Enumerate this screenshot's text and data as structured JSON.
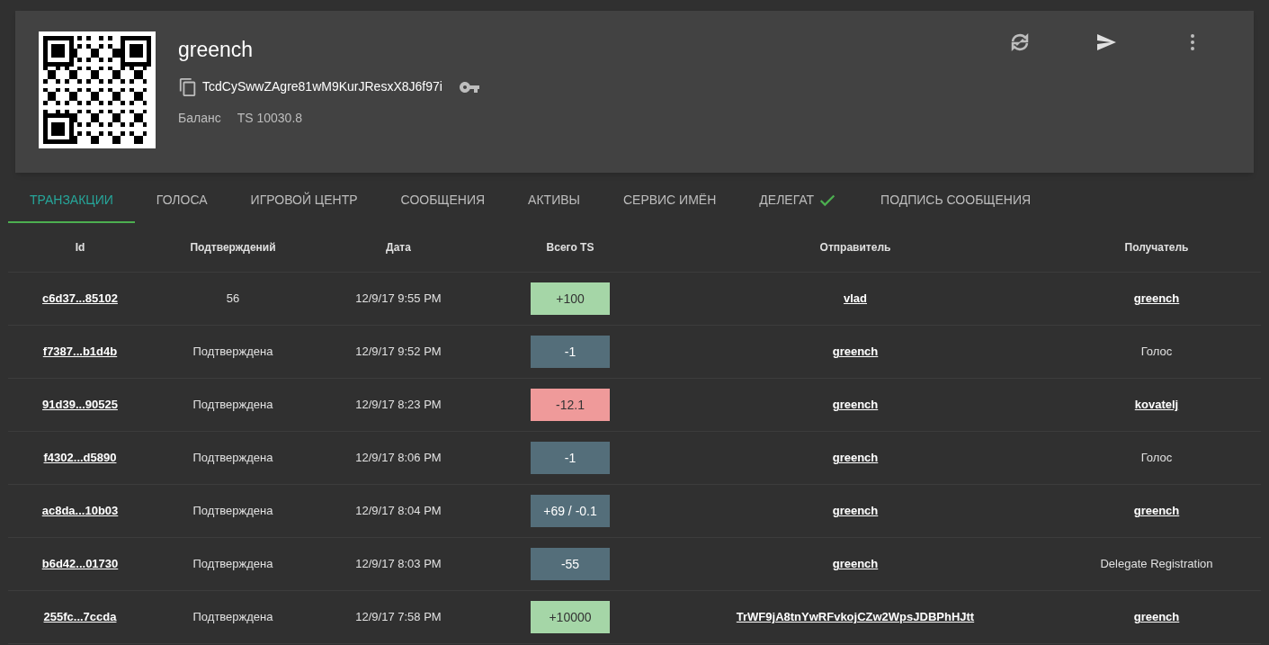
{
  "wallet": {
    "name": "greench",
    "address": "TcdCySwwZAgre81wM9KurJResxX8J6f97i",
    "balance_label": "Баланс",
    "balance": "TS 10030.8"
  },
  "tabs": [
    {
      "label": "ТРАНЗАКЦИИ",
      "selected": true,
      "check": false
    },
    {
      "label": "ГОЛОСА",
      "selected": false,
      "check": false
    },
    {
      "label": "ИГРОВОЙ ЦЕНТР",
      "selected": false,
      "check": false
    },
    {
      "label": "СООБЩЕНИЯ",
      "selected": false,
      "check": false
    },
    {
      "label": "АКТИВЫ",
      "selected": false,
      "check": false
    },
    {
      "label": "СЕРВИС ИМЁН",
      "selected": false,
      "check": false
    },
    {
      "label": "ДЕЛЕГАТ",
      "selected": false,
      "check": true
    },
    {
      "label": "ПОДПИСЬ СООБЩЕНИЯ",
      "selected": false,
      "check": false
    }
  ],
  "table": {
    "columns": [
      "Id",
      "Подтверждений",
      "Дата",
      "Всего TS",
      "Отправитель",
      "Получатель"
    ],
    "rows": [
      {
        "id": "c6d37...85102",
        "confirmations": "56",
        "date": "12/9/17 9:55 PM",
        "amount": "+100",
        "color": "#a5d6a7",
        "sender": "vlad",
        "recipient": "greench",
        "recipient_link": true
      },
      {
        "id": "f7387...b1d4b",
        "confirmations": "Подтверждена",
        "date": "12/9/17 9:52 PM",
        "amount": "-1",
        "color": "#546e7a",
        "sender": "greench",
        "recipient": "Голос",
        "recipient_link": false
      },
      {
        "id": "91d39...90525",
        "confirmations": "Подтверждена",
        "date": "12/9/17 8:23 PM",
        "amount": "-12.1",
        "color": "#ef9a9a",
        "sender": "greench",
        "recipient": "kovatelj",
        "recipient_link": true
      },
      {
        "id": "f4302...d5890",
        "confirmations": "Подтверждена",
        "date": "12/9/17 8:06 PM",
        "amount": "-1",
        "color": "#546e7a",
        "sender": "greench",
        "recipient": "Голос",
        "recipient_link": false
      },
      {
        "id": "ac8da...10b03",
        "confirmations": "Подтверждена",
        "date": "12/9/17 8:04 PM",
        "amount": "+69 / -0.1",
        "color": "#546e7a",
        "sender": "greench",
        "recipient": "greench",
        "recipient_link": true
      },
      {
        "id": "b6d42...01730",
        "confirmations": "Подтверждена",
        "date": "12/9/17 8:03 PM",
        "amount": "-55",
        "color": "#546e7a",
        "sender": "greench",
        "recipient": "Delegate Registration",
        "recipient_link": false
      },
      {
        "id": "255fc...7ccda",
        "confirmations": "Подтверждена",
        "date": "12/9/17 7:58 PM",
        "amount": "+10000",
        "color": "#a5d6a7",
        "sender": "TrWF9jA8tnYwRFvkojCZw2WpsJDBPhHJtt",
        "recipient": "greench",
        "recipient_link": true
      }
    ]
  }
}
